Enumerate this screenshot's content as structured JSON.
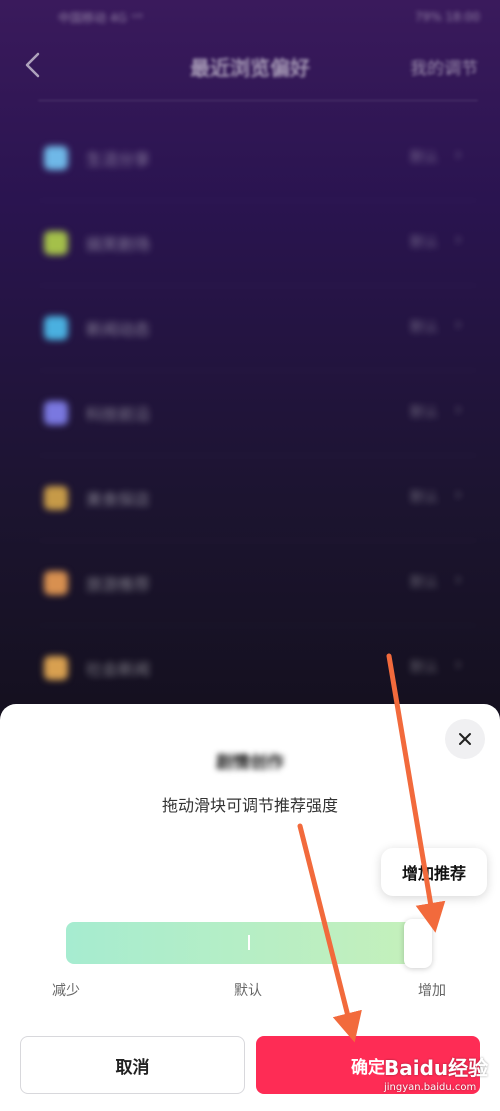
{
  "status_bar": {
    "left": "中国移动 4G  ⁺ᴴ",
    "right": "79% 18:00"
  },
  "header": {
    "title": "最近浏览偏好",
    "right_action": "我的调节"
  },
  "preferences": [
    {
      "name": "生活分享",
      "status": "默认",
      "icon_color": "#6fb8e8"
    },
    {
      "name": "搞笑剧场",
      "status": "默认",
      "icon_color": "#a4c04a"
    },
    {
      "name": "新闻动态",
      "status": "默认",
      "icon_color": "#4ab0e0"
    },
    {
      "name": "科技前沿",
      "status": "默认",
      "icon_color": "#7a78e0"
    },
    {
      "name": "美食探店",
      "status": "默认",
      "icon_color": "#c69a48"
    },
    {
      "name": "旅游推荐",
      "status": "默认",
      "icon_color": "#d89050"
    },
    {
      "name": "社会新闻",
      "status": "默认",
      "icon_color": "#d8a050"
    }
  ],
  "sheet": {
    "title": "剧情创作",
    "subtitle": "拖动滑块可调节推荐强度",
    "tooltip": "增加推荐",
    "slider": {
      "level": 1.0,
      "min_label": "减少",
      "mid_label": "默认",
      "max_label": "增加"
    },
    "cancel_label": "取消",
    "confirm_label": "确定"
  },
  "watermark": {
    "logo": "Baidu经验",
    "url": "jingyan.baidu.com"
  },
  "colors": {
    "accent": "#fe2c55",
    "slider_start": "#a6ecd0",
    "slider_end": "#c6f0ba",
    "arrow": "#f26a3c"
  }
}
